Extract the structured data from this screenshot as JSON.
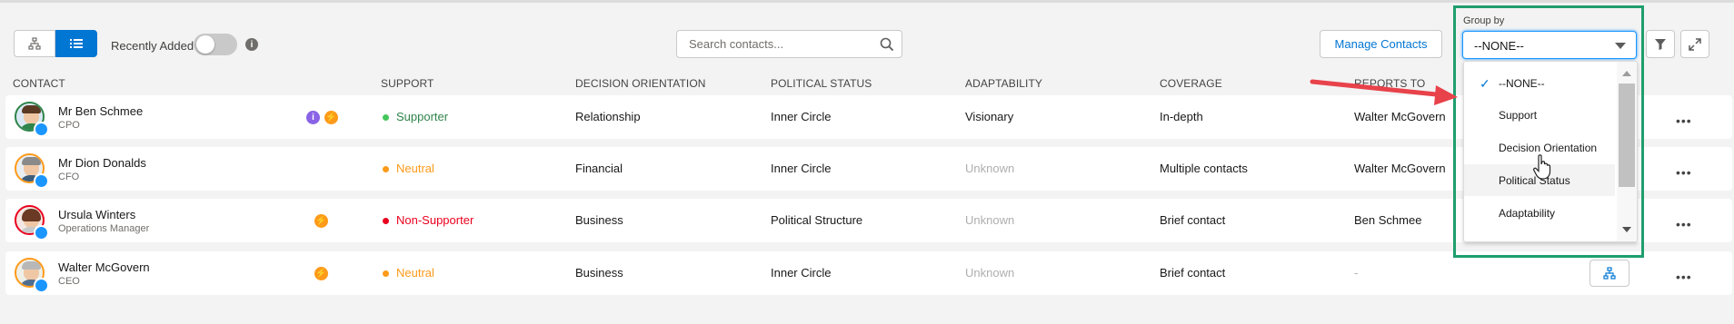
{
  "toolbar": {
    "recently_added_label": "Recently Added",
    "recently_added_on": false,
    "info_icon": "i",
    "search_placeholder": "Search contacts...",
    "manage_contacts_label": "Manage Contacts",
    "group_by_label": "Group by",
    "group_by_value": "--NONE--"
  },
  "columns": {
    "contact": "CONTACT",
    "support": "SUPPORT",
    "decision": "DECISION ORIENTATION",
    "political": "POLITICAL STATUS",
    "adaptability": "ADAPTABILITY",
    "coverage": "COVERAGE",
    "reports_to": "REPORTS TO"
  },
  "rows": [
    {
      "name": "Mr Ben Schmee",
      "title": "CPO",
      "support": "Supporter",
      "decision": "Relationship",
      "political": "Inner Circle",
      "adaptability": "Visionary",
      "coverage": "In-depth",
      "reports_to": "Walter McGovern"
    },
    {
      "name": "Mr Dion Donalds",
      "title": "CFO",
      "support": "Neutral",
      "decision": "Financial",
      "political": "Inner Circle",
      "adaptability": "Unknown",
      "coverage": "Multiple contacts",
      "reports_to": "Walter McGovern"
    },
    {
      "name": "Ursula Winters",
      "title": "Operations Manager",
      "support": "Non-Supporter",
      "decision": "Business",
      "political": "Political Structure",
      "adaptability": "Unknown",
      "coverage": "Brief contact",
      "reports_to": "Ben Schmee"
    },
    {
      "name": "Walter McGovern",
      "title": "CEO",
      "support": "Neutral",
      "decision": "Business",
      "political": "Inner Circle",
      "adaptability": "Unknown",
      "coverage": "Brief contact",
      "reports_to": "-"
    }
  ],
  "more_label": "•••",
  "dropdown": {
    "options": [
      "--NONE--",
      "Support",
      "Decision Orientation",
      "Political Status",
      "Adaptability"
    ],
    "selected": "--NONE--",
    "hovered": "Political Status"
  },
  "colors": {
    "accent": "#0176d3",
    "supporter": "#2e844a",
    "neutral": "#fe9a1a",
    "non_supporter": "#ea001e",
    "highlight_box": "#1f9e6e",
    "arrow": "#e8424a"
  }
}
